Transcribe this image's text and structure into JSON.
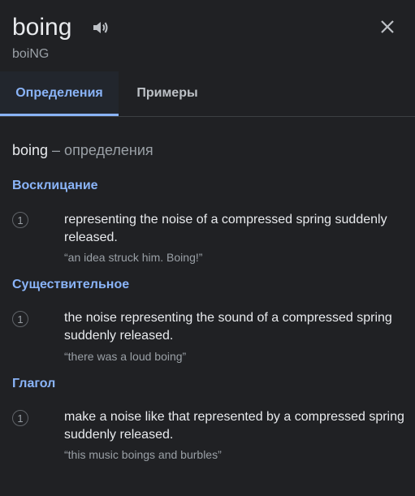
{
  "header": {
    "word": "boing",
    "phonetic": "boiNG",
    "speaker_icon": "speaker-icon",
    "close_icon": "close-icon"
  },
  "tabs": [
    {
      "label": "Определения",
      "active": true
    },
    {
      "label": "Примеры",
      "active": false
    }
  ],
  "section": {
    "word": "boing",
    "suffix": " – определения"
  },
  "senses": [
    {
      "pos": "Восклицание",
      "number": "1",
      "definition": "representing the noise of a compressed spring suddenly released.",
      "example": "“an idea struck him. Boing!”"
    },
    {
      "pos": "Существительное",
      "number": "1",
      "definition": "the noise representing the sound of a compressed spring suddenly released.",
      "example": "“there was a loud boing”"
    },
    {
      "pos": "Глагол",
      "number": "1",
      "definition": "make a noise like that represented by a compressed spring suddenly released.",
      "example": "“this music boings and burbles”"
    }
  ],
  "colors": {
    "background": "#202124",
    "accent": "#8ab4f8",
    "text": "#e8eaed",
    "muted": "#9aa0a6"
  }
}
